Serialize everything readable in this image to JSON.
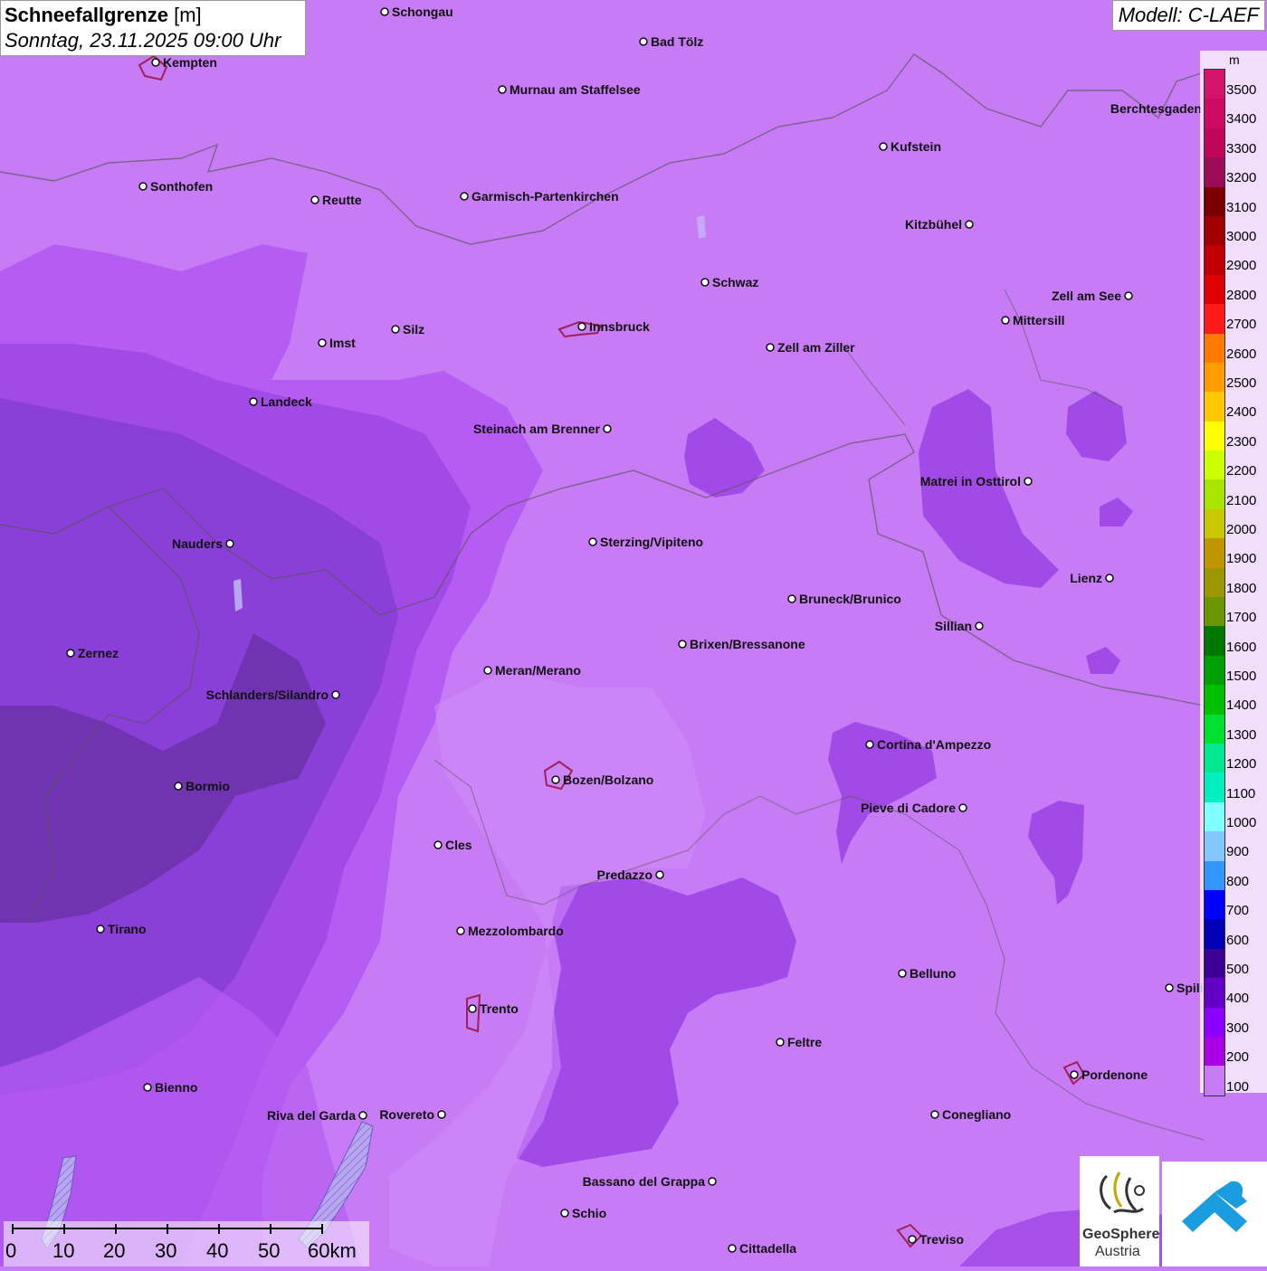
{
  "title": {
    "main": "Schneefallgrenze",
    "unit": "[m]",
    "datetime": "Sonntag, 23.11.2025 09:00 Uhr"
  },
  "model": "Modell: C-LAEF",
  "colors": {
    "base": "#c77cf5",
    "band_mid": "#b55cf2",
    "band_deep": "#a24ae8",
    "band_dark": "#8a3fd8",
    "band_darkest": "#6a32a8"
  },
  "cities": [
    {
      "name": "Schongau",
      "dot_left": true
    },
    {
      "name": "Bad Tölz",
      "dot_left": true
    },
    {
      "name": "Kempten",
      "dot_left": true
    },
    {
      "name": "Murnau am Staffelsee",
      "dot_left": true
    },
    {
      "name": "Berchtesgaden",
      "dot_left": false
    },
    {
      "name": "Kufstein",
      "dot_left": true
    },
    {
      "name": "Sonthofen",
      "dot_left": true
    },
    {
      "name": "Reutte",
      "dot_left": true
    },
    {
      "name": "Garmisch-Partenkirchen",
      "dot_left": true
    },
    {
      "name": "Kitzbühel",
      "dot_left": false
    },
    {
      "name": "Schwaz",
      "dot_left": true
    },
    {
      "name": "Zell am See",
      "dot_left": false
    },
    {
      "name": "Innsbruck",
      "dot_left": true
    },
    {
      "name": "Mittersill",
      "dot_left": true
    },
    {
      "name": "Imst",
      "dot_left": true
    },
    {
      "name": "Silz",
      "dot_left": true
    },
    {
      "name": "Zell am Ziller",
      "dot_left": true
    },
    {
      "name": "Landeck",
      "dot_left": true
    },
    {
      "name": "Steinach am Brenner",
      "dot_left": false
    },
    {
      "name": "Matrei in Osttirol",
      "dot_left": false
    },
    {
      "name": "Nauders",
      "dot_left": false
    },
    {
      "name": "Sterzing/Vipiteno",
      "dot_left": true
    },
    {
      "name": "Lienz",
      "dot_left": false
    },
    {
      "name": "Bruneck/Brunico",
      "dot_left": true
    },
    {
      "name": "Sillian",
      "dot_left": false
    },
    {
      "name": "Brixen/Bressanone",
      "dot_left": true
    },
    {
      "name": "Zernez",
      "dot_left": true
    },
    {
      "name": "Meran/Merano",
      "dot_left": true
    },
    {
      "name": "Schlanders/Silandro",
      "dot_left": false
    },
    {
      "name": "Cortina d'Ampezzo",
      "dot_left": true
    },
    {
      "name": "Bozen/Bolzano",
      "dot_left": true
    },
    {
      "name": "Bormio",
      "dot_left": true
    },
    {
      "name": "Pieve di Cadore",
      "dot_left": false
    },
    {
      "name": "Cles",
      "dot_left": true
    },
    {
      "name": "Predazzo",
      "dot_left": false
    },
    {
      "name": "Tirano",
      "dot_left": true
    },
    {
      "name": "Mezzolombardo",
      "dot_left": true
    },
    {
      "name": "Belluno",
      "dot_left": true
    },
    {
      "name": "Spili",
      "dot_left": true
    },
    {
      "name": "Trento",
      "dot_left": true
    },
    {
      "name": "Feltre",
      "dot_left": true
    },
    {
      "name": "Pordenone",
      "dot_left": true
    },
    {
      "name": "Bienno",
      "dot_left": true
    },
    {
      "name": "Riva del Garda",
      "dot_left": false
    },
    {
      "name": "Rovereto",
      "dot_left": false
    },
    {
      "name": "Conegliano",
      "dot_left": true
    },
    {
      "name": "Bassano del Grappa",
      "dot_left": false
    },
    {
      "name": "Schio",
      "dot_left": true
    },
    {
      "name": "Treviso",
      "dot_left": true
    },
    {
      "name": "Cittadella",
      "dot_left": true
    }
  ],
  "legend": {
    "unit": "m",
    "levels": [
      {
        "label": "3500",
        "color": "#d4146c"
      },
      {
        "label": "3400",
        "color": "#cc0a64"
      },
      {
        "label": "3300",
        "color": "#c0055a"
      },
      {
        "label": "3200",
        "color": "#9c0a5a"
      },
      {
        "label": "3100",
        "color": "#7a0000"
      },
      {
        "label": "3000",
        "color": "#a00000"
      },
      {
        "label": "2900",
        "color": "#c00000"
      },
      {
        "label": "2800",
        "color": "#e00000"
      },
      {
        "label": "2700",
        "color": "#ff1a1a"
      },
      {
        "label": "2600",
        "color": "#ff7a00"
      },
      {
        "label": "2500",
        "color": "#ff9d00"
      },
      {
        "label": "2400",
        "color": "#ffc800"
      },
      {
        "label": "2300",
        "color": "#ffff00"
      },
      {
        "label": "2200",
        "color": "#ccff00"
      },
      {
        "label": "2100",
        "color": "#a8e600"
      },
      {
        "label": "2000",
        "color": "#c8c800"
      },
      {
        "label": "1900",
        "color": "#c09600"
      },
      {
        "label": "1800",
        "color": "#9c9600"
      },
      {
        "label": "1700",
        "color": "#6c9600"
      },
      {
        "label": "1600",
        "color": "#007800"
      },
      {
        "label": "1500",
        "color": "#00a000"
      },
      {
        "label": "1400",
        "color": "#00c000"
      },
      {
        "label": "1300",
        "color": "#00e030"
      },
      {
        "label": "1200",
        "color": "#00e890"
      },
      {
        "label": "1100",
        "color": "#00f0c0"
      },
      {
        "label": "1000",
        "color": "#80ffff"
      },
      {
        "label": "900",
        "color": "#80c8ff"
      },
      {
        "label": "800",
        "color": "#3296ff"
      },
      {
        "label": "700",
        "color": "#0000ff"
      },
      {
        "label": "600",
        "color": "#0000b4"
      },
      {
        "label": "500",
        "color": "#3c0096"
      },
      {
        "label": "400",
        "color": "#6400c8"
      },
      {
        "label": "300",
        "color": "#8c00ff"
      },
      {
        "label": "200",
        "color": "#aa00e6"
      },
      {
        "label": "100",
        "color": "#c77cf5"
      }
    ]
  },
  "scalebar": {
    "ticks": [
      "0",
      "10",
      "20",
      "30",
      "40",
      "50",
      "60km"
    ]
  },
  "logo": {
    "name_line1": "GeoSphere",
    "name_line2": "Austria"
  }
}
